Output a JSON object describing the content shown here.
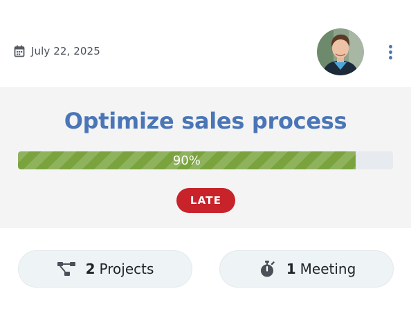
{
  "header": {
    "date": "July 22, 2025",
    "icons": {
      "date": "calendar-icon",
      "more": "more-vertical-icon"
    }
  },
  "card": {
    "title": "Optimize sales process",
    "progress": {
      "percent": 90,
      "label": "90%",
      "color": "#7aa33e",
      "track_color": "#e7eaee"
    },
    "status": {
      "label": "LATE",
      "color": "#c8222a"
    }
  },
  "stats": {
    "projects": {
      "count": "2",
      "label": "Projects",
      "icon": "project-tree-icon"
    },
    "meetings": {
      "count": "1",
      "label": "Meeting",
      "icon": "stopwatch-icon"
    }
  },
  "colors": {
    "accent": "#4a76b7",
    "pill_bg": "#eef3f5",
    "hero_bg": "#f4f4f4"
  }
}
